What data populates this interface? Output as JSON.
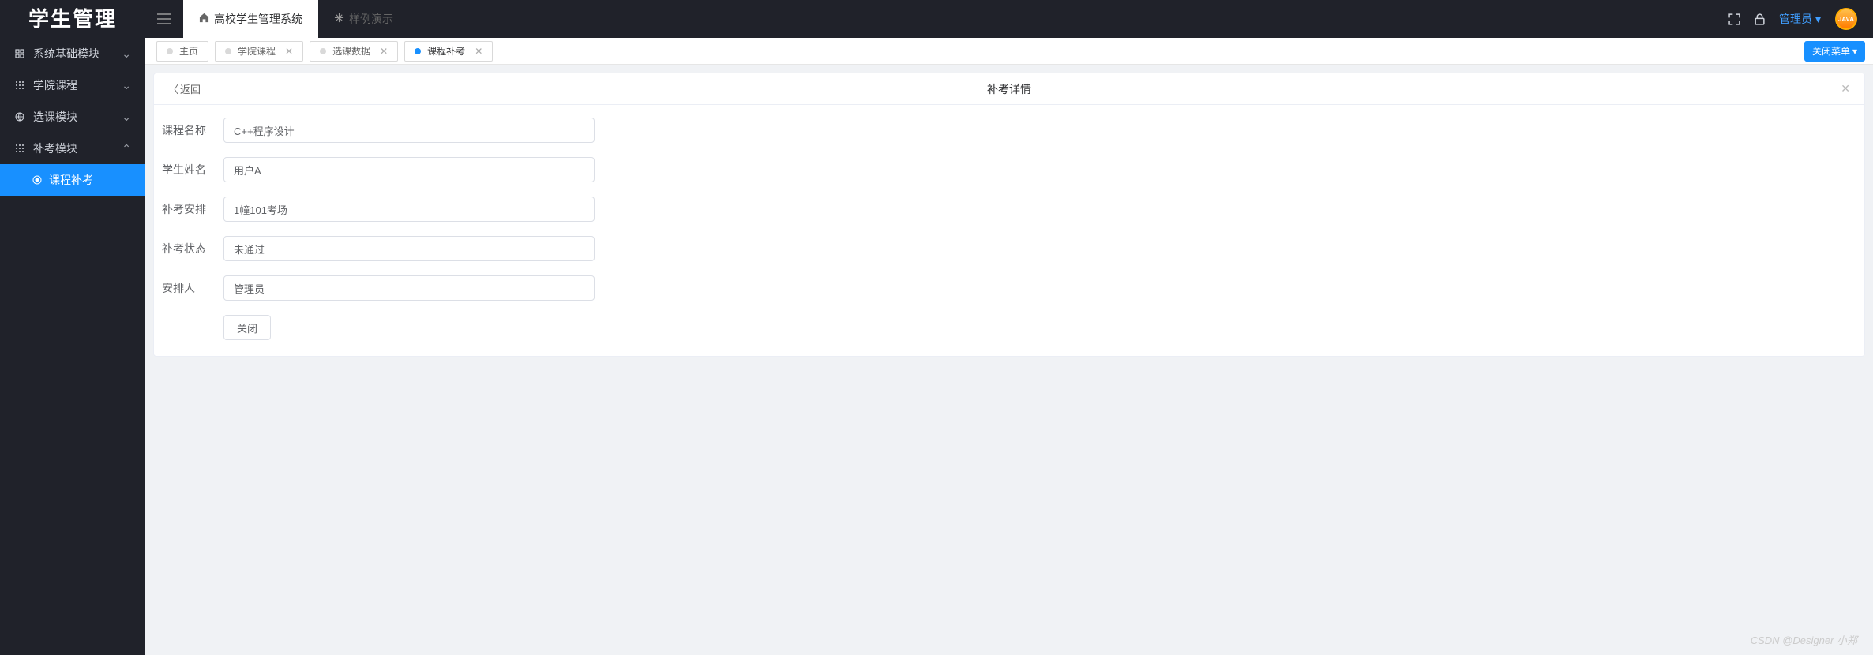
{
  "app_title": "学生管理",
  "header": {
    "top_tabs": [
      {
        "label": "高校学生管理系统",
        "active": true
      },
      {
        "label": "样例演示",
        "active": false
      }
    ],
    "user_label": "管理员",
    "avatar_text": "JAVA"
  },
  "sidebar": {
    "items": [
      {
        "label": "系统基础模块",
        "expanded": false
      },
      {
        "label": "学院课程",
        "expanded": false
      },
      {
        "label": "选课模块",
        "expanded": false
      },
      {
        "label": "补考模块",
        "expanded": true
      }
    ],
    "sub_item": "课程补考"
  },
  "page_tabs": {
    "items": [
      {
        "label": "主页",
        "closable": false,
        "active": false
      },
      {
        "label": "学院课程",
        "closable": true,
        "active": false
      },
      {
        "label": "选课数据",
        "closable": true,
        "active": false
      },
      {
        "label": "课程补考",
        "closable": true,
        "active": true
      }
    ],
    "close_menu_label": "关闭菜单"
  },
  "panel": {
    "back_label": "返回",
    "title": "补考详情",
    "close_btn": "关闭",
    "fields": [
      {
        "label": "课程名称",
        "value": "C++程序设计"
      },
      {
        "label": "学生姓名",
        "value": "用户A"
      },
      {
        "label": "补考安排",
        "value": "1幢101考场"
      },
      {
        "label": "补考状态",
        "value": "未通过"
      },
      {
        "label": "安排人",
        "value": "管理员"
      }
    ]
  },
  "watermark": "CSDN @Designer 小郑"
}
